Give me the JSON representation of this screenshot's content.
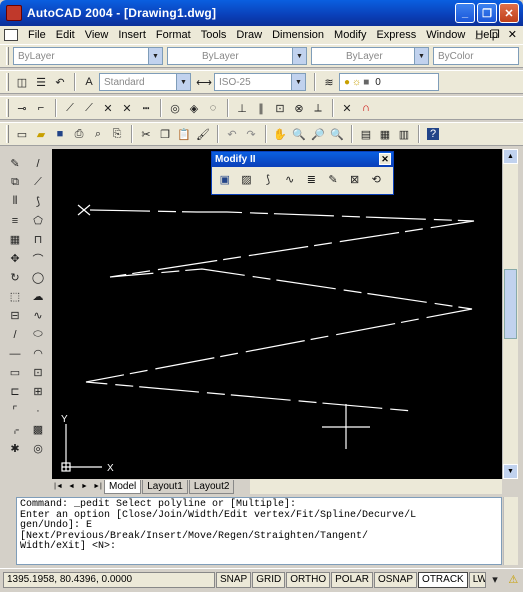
{
  "window": {
    "title": "AutoCAD 2004 - [Drawing1.dwg]",
    "buttons": {
      "minimize": "_",
      "restore": "❐",
      "close": "✕"
    }
  },
  "menu": {
    "items": [
      "File",
      "Edit",
      "View",
      "Insert",
      "Format",
      "Tools",
      "Draw",
      "Dimension",
      "Modify",
      "Express",
      "Window",
      "Help"
    ],
    "right": [
      "_",
      "❐",
      "✕"
    ]
  },
  "properties_bar": {
    "layer_value": "ByLayer",
    "linetype_value": "ByLayer",
    "lineweight_value": "ByLayer",
    "color_value": "ByColor"
  },
  "styles_bar": {
    "text_style": "Standard",
    "dim_style": "ISO-25",
    "layer_number": "0"
  },
  "float_toolbar": {
    "title": "Modify II",
    "close": "✕"
  },
  "ucs": {
    "x_label": "X",
    "y_label": "Y"
  },
  "tabs": {
    "nav": [
      "|◄",
      "◄",
      "►",
      "►|"
    ],
    "items": [
      "Model",
      "Layout1",
      "Layout2"
    ],
    "active": "Model"
  },
  "command": {
    "lines": [
      "Command: _pedit Select polyline or [Multiple]:",
      "Enter an option [Close/Join/Width/Edit vertex/Fit/Spline/Decurve/L",
      "gen/Undo]: E",
      "[Next/Previous/Break/Insert/Move/Regen/Straighten/Tangent/",
      "Width/eXit] <N>:"
    ]
  },
  "status": {
    "coords": "1395.1958, 80.4396, 0.0000",
    "toggles": [
      {
        "label": "SNAP",
        "on": false
      },
      {
        "label": "GRID",
        "on": false
      },
      {
        "label": "ORTHO",
        "on": false
      },
      {
        "label": "POLAR",
        "on": false
      },
      {
        "label": "OSNAP",
        "on": false
      },
      {
        "label": "OTRACK",
        "on": true
      },
      {
        "label": "LWT",
        "on": false
      }
    ]
  },
  "colors": {
    "canvas_bg": "#000000",
    "title_blue": "#0a3fb8",
    "drawing_line": "#ffffff"
  }
}
